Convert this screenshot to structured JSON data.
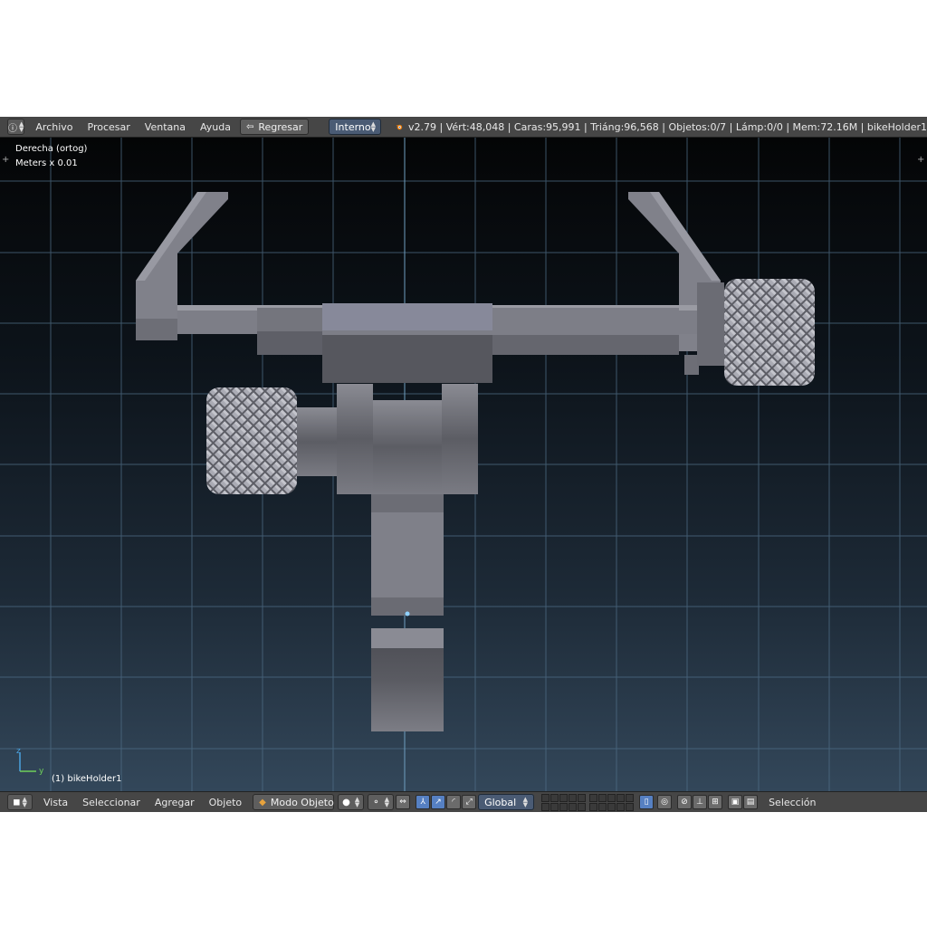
{
  "topbar": {
    "menus": [
      "Archivo",
      "Procesar",
      "Ventana",
      "Ayuda"
    ],
    "back_button": "Regresar",
    "render_engine": "Interno",
    "stats": "v2.79 | Vért:48,048 | Caras:95,991 | Triáng:96,568 | Objetos:0/7 | Lámp:0/0 | Mem:72.16M | bikeHolder1"
  },
  "viewport": {
    "view_name": "Derecha (ortog)",
    "units": "Meters x 0.01",
    "object_label": "(1) bikeHolder1",
    "axis_z": "z",
    "axis_y": "y"
  },
  "bottombar": {
    "menus": [
      "Vista",
      "Seleccionar",
      "Agregar",
      "Objeto"
    ],
    "mode": "Modo Objeto",
    "orientation": "Global",
    "selection_label": "Selección"
  },
  "colors": {
    "header_bg": "#464646",
    "dropdown_blue": "#4a5b74",
    "active_blue": "#5680c2",
    "grid_line": "#6a8aa0",
    "model_gray": "#7e7e88"
  },
  "icons": [
    "info-icon",
    "blender-logo-icon",
    "cube-icon",
    "sphere-shading-icon",
    "pivot-icon",
    "manipulator-icon",
    "layers-icon",
    "lock-icon",
    "snap-icon",
    "render-icon"
  ]
}
